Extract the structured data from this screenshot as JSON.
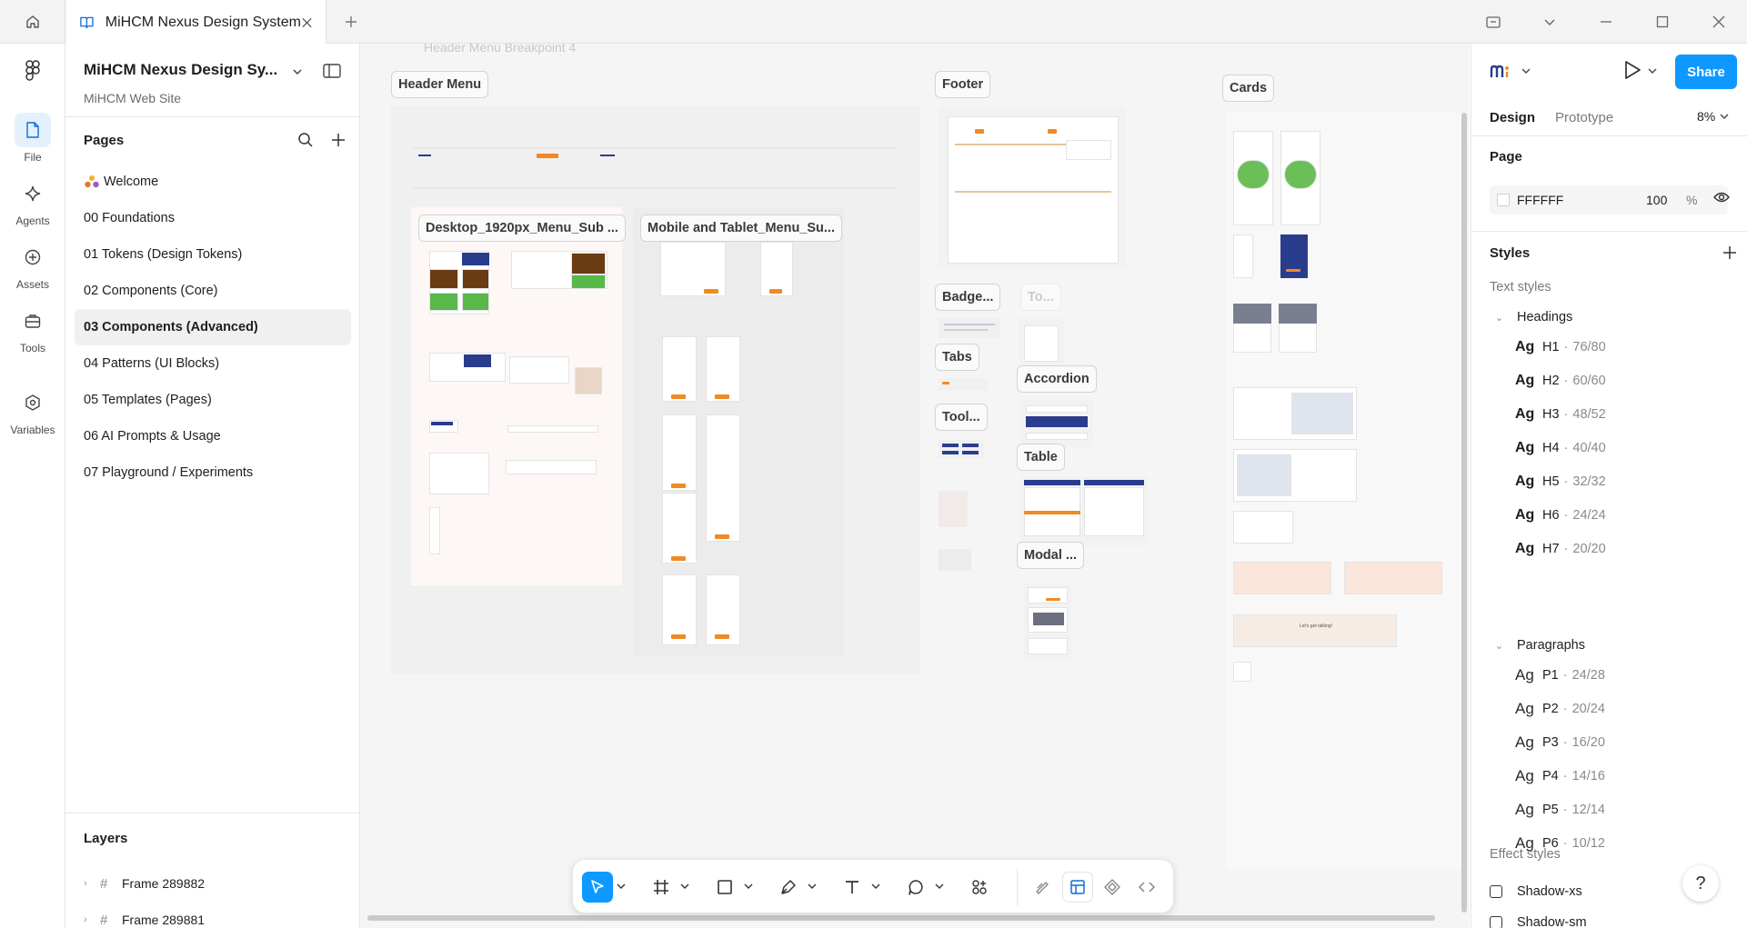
{
  "titlebar": {
    "tab_title": "MiHCM Nexus Design System",
    "icons": [
      "home-icon",
      "book-icon",
      "close-icon",
      "plus-icon",
      "folder-icon",
      "chevron-down-icon",
      "minimize-icon",
      "maximize-icon",
      "window-close-icon"
    ]
  },
  "rail": {
    "items": [
      {
        "label": "File",
        "icon": "file-icon",
        "active": true
      },
      {
        "label": "Agents",
        "icon": "agents-icon"
      },
      {
        "label": "Assets",
        "icon": "assets-icon"
      },
      {
        "label": "Tools",
        "icon": "toolbox-icon"
      },
      {
        "label": "Variables",
        "icon": "variables-icon"
      }
    ]
  },
  "left_panel": {
    "file_title": "MiHCM Nexus Design Sy...",
    "subtitle": "MiHCM Web Site",
    "pages_heading": "Pages",
    "pages": [
      {
        "label": "Welcome",
        "emoji": true
      },
      {
        "label": "00 Foundations"
      },
      {
        "label": "01 Tokens (Design Tokens)"
      },
      {
        "label": "02 Components (Core)"
      },
      {
        "label": "03 Components (Advanced)",
        "selected": true
      },
      {
        "label": "04 Patterns (UI Blocks)"
      },
      {
        "label": "05 Templates (Pages)"
      },
      {
        "label": "06 AI Prompts & Usage"
      },
      {
        "label": "07 Playground / Experiments"
      }
    ],
    "layers_heading": "Layers",
    "layers": [
      {
        "label": "Frame 289882"
      },
      {
        "label": "Frame 289881"
      }
    ]
  },
  "canvas": {
    "faint_text": "Header Menu Breakpoint 4",
    "sections": {
      "header_menu": "Header Menu",
      "desktop_menu": "Desktop_1920px_Menu_Sub ...",
      "mobile_menu": "Mobile and Tablet_Menu_Su...",
      "footer": "Footer",
      "cards": "Cards",
      "badge": "Badge...",
      "to": "To...",
      "tabs": "Tabs",
      "accordion": "Accordion",
      "tooltip": "Tool...",
      "table": "Table",
      "modal": "Modal ..."
    },
    "cta_text": "Let's get talking!"
  },
  "toolbar": {
    "tools": [
      {
        "name": "move-tool",
        "icon": "cursor-icon",
        "active": true
      },
      {
        "name": "frame-tool",
        "icon": "frame-icon"
      },
      {
        "name": "rectangle-tool",
        "icon": "rectangle-icon"
      },
      {
        "name": "pen-tool",
        "icon": "pen-icon"
      },
      {
        "name": "text-tool",
        "icon": "text-icon"
      },
      {
        "name": "comment-tool",
        "icon": "comment-icon"
      },
      {
        "name": "actions-tool",
        "icon": "actions-icon"
      }
    ],
    "modes": [
      "draw-mode-icon",
      "design-mode-icon",
      "prototype-mode-icon",
      "dev-mode-icon"
    ]
  },
  "right_panel": {
    "share_label": "Share",
    "tabs": [
      "Design",
      "Prototype"
    ],
    "active_tab": "Design",
    "zoom": "8%",
    "page_heading": "Page",
    "page_color": "FFFFFF",
    "page_opacity": "100",
    "page_opacity_unit": "%",
    "styles_heading": "Styles",
    "text_styles_label": "Text styles",
    "headings_group": "Headings",
    "headings": [
      {
        "name": "H1",
        "value": "76/80"
      },
      {
        "name": "H2",
        "value": "60/60"
      },
      {
        "name": "H3",
        "value": "48/52"
      },
      {
        "name": "H4",
        "value": "40/40"
      },
      {
        "name": "H5",
        "value": "32/32"
      },
      {
        "name": "H6",
        "value": "24/24"
      },
      {
        "name": "H7",
        "value": "20/20"
      }
    ],
    "paragraphs_group": "Paragraphs",
    "paragraphs": [
      {
        "name": "P1",
        "value": "24/28"
      },
      {
        "name": "P2",
        "value": "20/24"
      },
      {
        "name": "P3",
        "value": "16/20"
      },
      {
        "name": "P4",
        "value": "14/16"
      },
      {
        "name": "P5",
        "value": "12/14"
      },
      {
        "name": "P6",
        "value": "10/12"
      }
    ],
    "ag_glyph": "Ag",
    "dot_sep": "·",
    "effect_styles_label": "Effect styles",
    "effects": [
      "Shadow-xs",
      "Shadow-sm"
    ],
    "help_label": "?"
  },
  "colors": {
    "accent": "#0d99ff",
    "brand_orange": "#f08a24",
    "brand_navy": "#2a3c8c",
    "canvas_bg": "#f5f5f5"
  }
}
